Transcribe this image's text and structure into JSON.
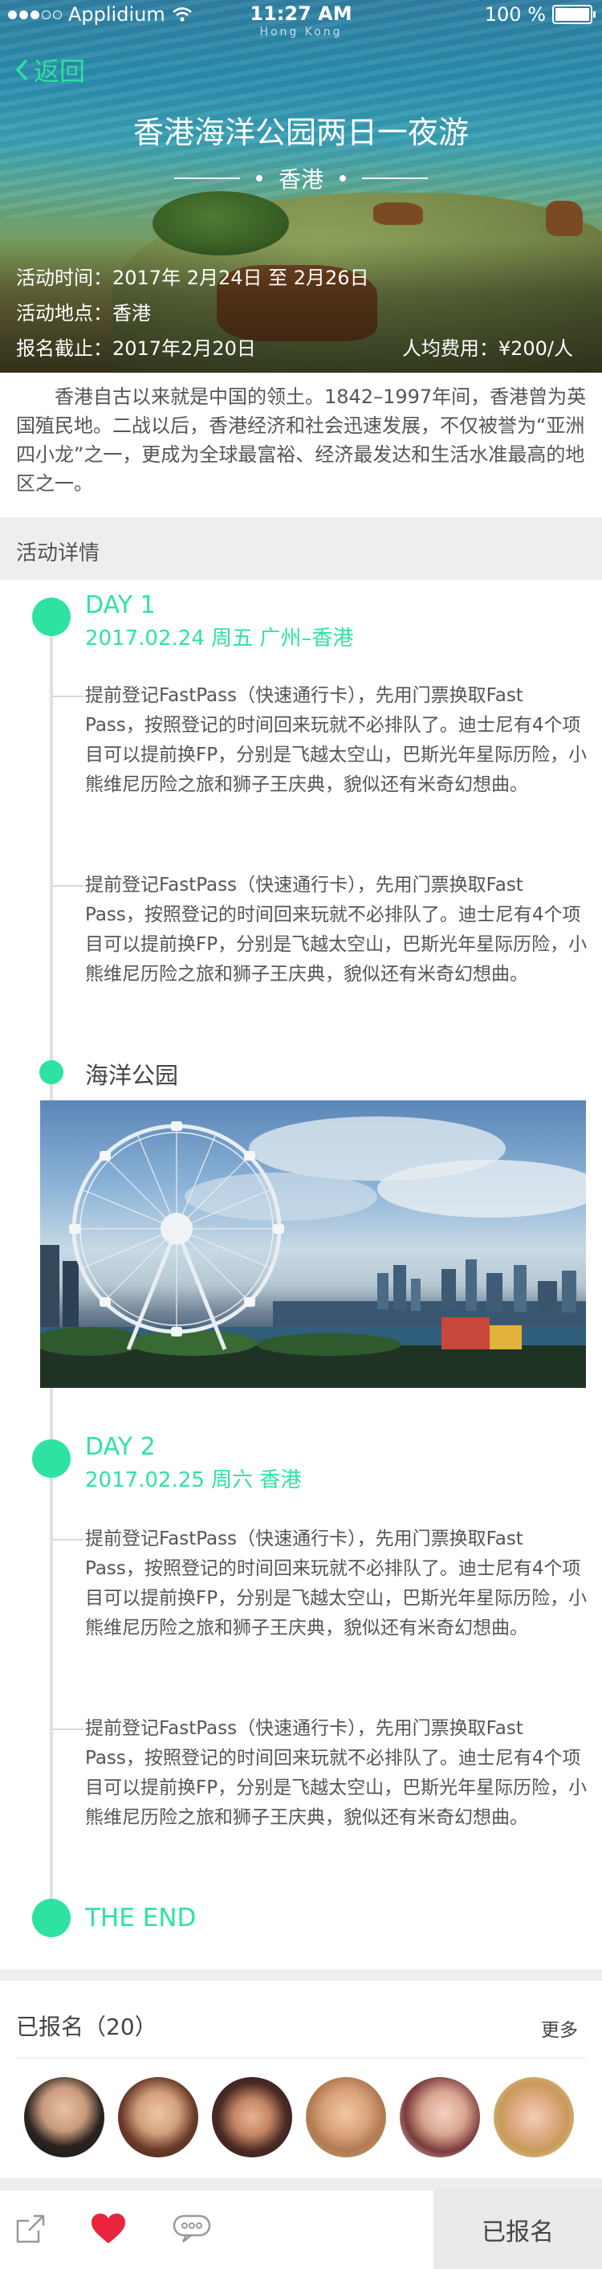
{
  "status_bar": {
    "carrier": "Applidium",
    "time": "11:27 AM",
    "subtitle": "Hong Kong",
    "battery": "100 %"
  },
  "header": {
    "back_label": "返回",
    "title": "香港海洋公园两日一夜游",
    "location": "香港"
  },
  "event_info": {
    "time": "活动时间：2017年 2月24日 至 2月26日",
    "place": "活动地点：香港",
    "deadline": "报名截止：2017年2月20日",
    "fee": "人均费用：¥200/人"
  },
  "intro": "香港自古以来就是中国的领土。1842–1997年间，香港曾为英国殖民地。二战以后，香港经济和社会迅速发展，不仅被誉为“亚洲四小龙”之一，更成为全球最富裕、经济最发达和生活水准最高的地区之一。",
  "details_section_title": "活动详情",
  "days": [
    {
      "title": "DAY 1",
      "subtitle": "2017.02.24   周五   广州–香港",
      "items": [
        "提前登记FastPass（快速通行卡），先用门票换取Fast Pass，按照登记的时间回来玩就不必排队了。迪士尼有4个项目可以提前换FP，分别是飞越太空山，巴斯光年星际历险，小熊维尼历险之旅和狮子王庆典，貌似还有米奇幻想曲。",
        "提前登记FastPass（快速通行卡），先用门票换取Fast Pass，按照登记的时间回来玩就不必排队了。迪士尼有4个项目可以提前换FP，分别是飞越太空山，巴斯光年星际历险，小熊维尼历险之旅和狮子王庆典，貌似还有米奇幻想曲。"
      ]
    },
    {
      "title": "DAY 2",
      "subtitle": "2017.02.25   周六   香港",
      "items": [
        "提前登记FastPass（快速通行卡），先用门票换取Fast Pass，按照登记的时间回来玩就不必排队了。迪士尼有4个项目可以提前换FP，分别是飞越太空山，巴斯光年星际历险，小熊维尼历险之旅和狮子王庆典，貌似还有米奇幻想曲。",
        "提前登记FastPass（快速通行卡），先用门票换取Fast Pass，按照登记的时间回来玩就不必排队了。迪士尼有4个项目可以提前换FP，分别是飞越太空山，巴斯光年星际历险，小熊维尼历险之旅和狮子王庆典，貌似还有米奇幻想曲。"
      ]
    }
  ],
  "poi": {
    "label": "海洋公园"
  },
  "end_label": "THE END",
  "signup": {
    "title": "已报名（20）",
    "more": "更多",
    "avatars": [
      "avatar-1",
      "avatar-2",
      "avatar-3",
      "avatar-4",
      "avatar-5",
      "avatar-6"
    ]
  },
  "bottom_bar": {
    "share_icon": "share-icon",
    "like_icon": "heart-icon",
    "comment_icon": "comment-icon",
    "join_label": "已报名"
  },
  "colors": {
    "accent": "#2ee3a2",
    "heart": "#e8253d"
  }
}
